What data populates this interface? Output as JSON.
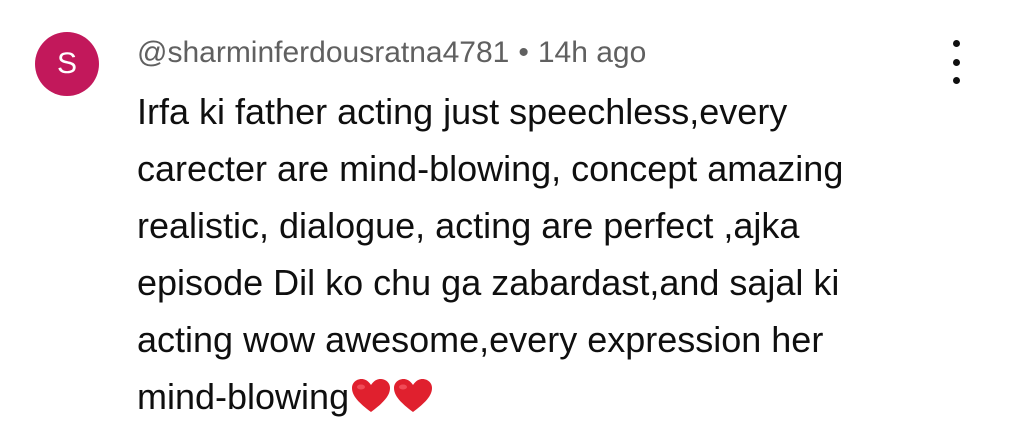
{
  "comment": {
    "avatar_letter": "S",
    "avatar_color": "#c2185b",
    "username": "@sharminferdousratna4781",
    "separator": "•",
    "timestamp": "14h ago",
    "menu_icon": "more-vert-icon",
    "text_lines": [
      "Irfa ki father acting just speechless,every",
      "carecter are mind-blowing, concept amazing",
      "realistic, dialogue, acting are perfect ,ajka",
      "episode Dil ko chu ga zabardast,and sajal ki",
      "acting wow awesome,every expression her",
      "mind-blowing"
    ],
    "emojis": [
      "❤️",
      "❤️"
    ],
    "heart_color": "#e0202e"
  }
}
